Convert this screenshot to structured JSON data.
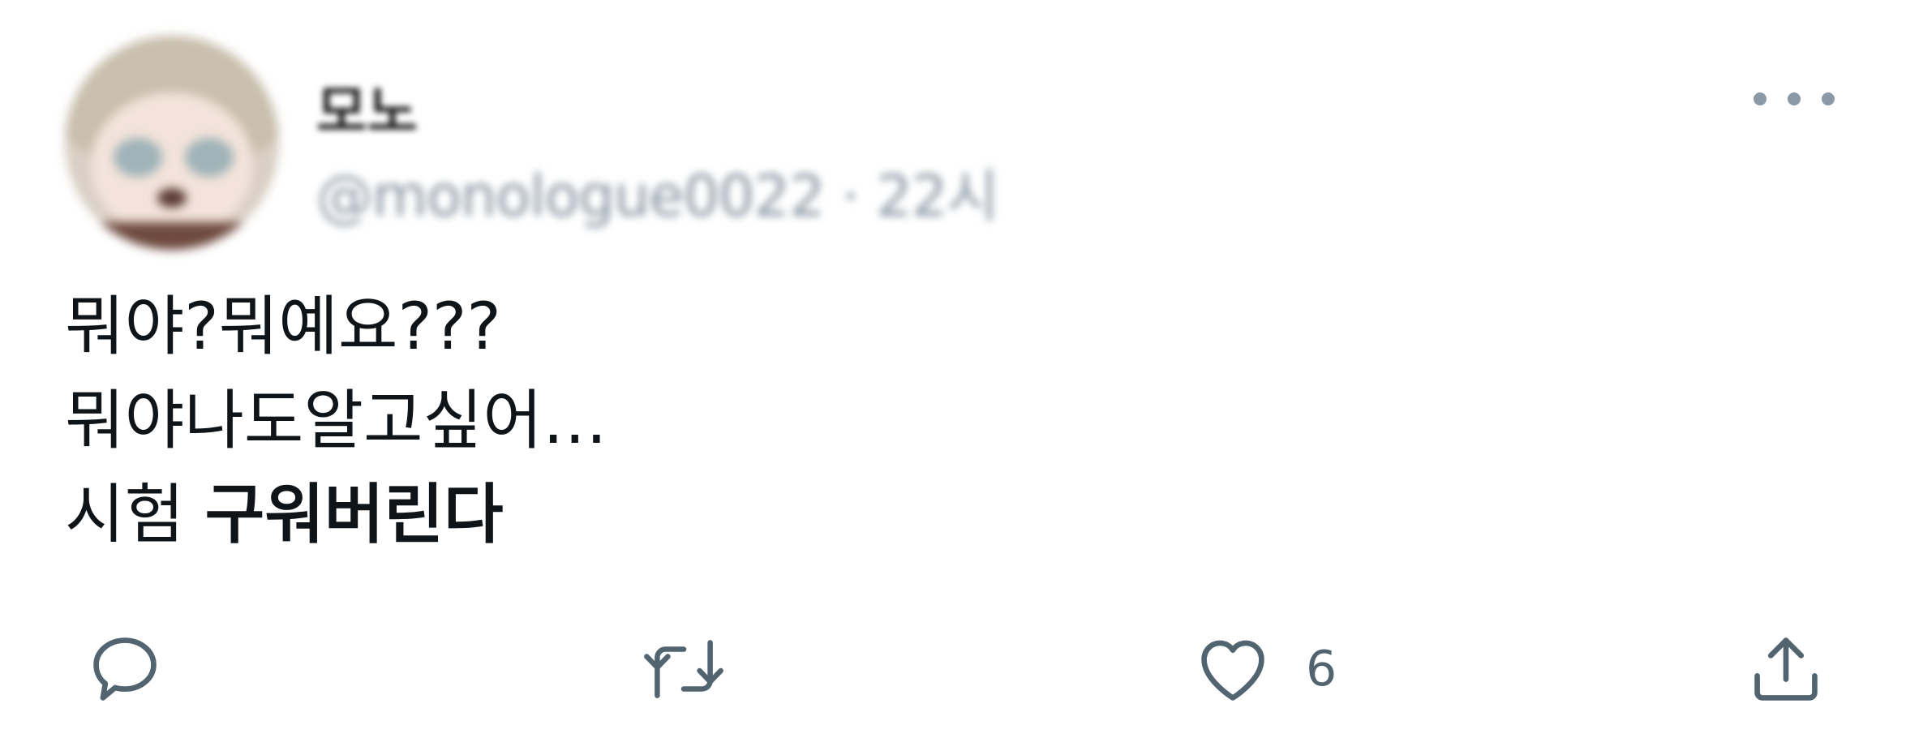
{
  "tweet": {
    "author": {
      "display_name": "모노",
      "handle": "@monologue0022",
      "separator": "·",
      "timestamp": "22시"
    },
    "text_lines": [
      "뭐야?뭐예요???",
      "뭐야나도알고싶어…"
    ],
    "last_line_regular": "시험 ",
    "last_line_bold": "구워버린다",
    "actions": {
      "reply_icon": "speech-bubble-icon",
      "retweet_icon": "retweet-arrows-icon",
      "like_icon": "heart-icon",
      "like_count": "6",
      "share_icon": "share-upload-icon",
      "more_icon": "three-dots-icon"
    },
    "colors": {
      "text": "#0f1419",
      "secondary": "#536471",
      "muted": "#8b98a5"
    }
  }
}
